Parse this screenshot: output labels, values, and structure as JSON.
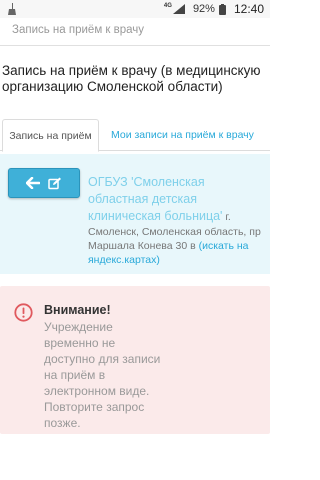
{
  "status_bar": {
    "network": "4G",
    "battery": "92%",
    "time": "12:40",
    "icons": [
      "broom-icon",
      "signal-icon",
      "battery-icon"
    ]
  },
  "top_bar": {
    "title": "Запись на приём к врачу"
  },
  "page": {
    "title": "Запись на приём к врачу (в медицинскую организацию Смоленской области)"
  },
  "tabs": [
    {
      "label": "Запись на приём",
      "active": true
    },
    {
      "label": "Мои записи на приём к врачу",
      "active": false
    }
  ],
  "organization": {
    "name": "ОГБУЗ 'Смоленская областная детская клиническая больница'",
    "address": "г. Смоленск, Смоленская область, пр Маршала Конева 30 в",
    "map_link": "(искать на яндекс.картах)",
    "button_icons": [
      "arrow-left-icon",
      "edit-icon"
    ]
  },
  "alert": {
    "title": "Внимание!",
    "text": "Учреждение временно не доступно для записи на приём в электронном виде. Повторите запрос позже.",
    "icon": "exclamation-circle-icon"
  },
  "colors": {
    "accent": "#29a9d9",
    "button": "#3fb0d8",
    "info_bg": "#e8f7fb",
    "alert_bg": "#fbeaea",
    "alert_icon": "#e0595e"
  }
}
